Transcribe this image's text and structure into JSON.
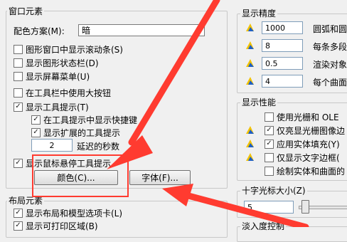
{
  "window_elements": {
    "title": "窗口元素",
    "color_scheme_label": "配色方案(M):",
    "color_scheme_value": "暗",
    "checkboxes": [
      {
        "label": "图形窗口中显示滚动条(S)",
        "checked": false
      },
      {
        "label": "显示图形状态栏(D)",
        "checked": false
      },
      {
        "label": "显示屏幕菜单(U)",
        "checked": false
      },
      {
        "label": "在工具栏中使用大按钮",
        "checked": false
      },
      {
        "label": "显示工具提示(T)",
        "checked": true
      },
      {
        "label": "在工具提示中显示快捷键",
        "checked": true
      },
      {
        "label": "显示扩展的工具提示",
        "checked": true
      }
    ],
    "delay_value": "2",
    "delay_label": "延迟的秒数",
    "rollover_checkbox": {
      "label": "显示鼠标悬停工具提示",
      "checked": true
    },
    "colors_button": "颜色(C)...",
    "fonts_button": "字体(F)..."
  },
  "layout_elements": {
    "title": "布局元素",
    "checkboxes": [
      {
        "label": "显示布局和模型选项卡(L)",
        "checked": true
      },
      {
        "label": "显示可打印区域(B)",
        "checked": true
      }
    ]
  },
  "display_resolution": {
    "title": "显示精度",
    "items": [
      {
        "value": "1000",
        "label": "圆弧和圆"
      },
      {
        "value": "8",
        "label": "每条多段"
      },
      {
        "value": "0.5",
        "label": "渲染对象"
      },
      {
        "value": "4",
        "label": "每个曲面"
      }
    ]
  },
  "display_performance": {
    "title": "显示性能",
    "items": [
      {
        "label": "使用光栅和 OLE",
        "checked": false,
        "icon": false
      },
      {
        "label": "仅亮显光栅图像边",
        "checked": true,
        "icon": true
      },
      {
        "label": "应用实体填充(Y)",
        "checked": true,
        "icon": true
      },
      {
        "label": "仅显示文字边框(",
        "checked": false,
        "icon": true
      },
      {
        "label": "绘制实体和曲面的",
        "checked": false,
        "icon": false
      }
    ]
  },
  "crosshair": {
    "title": "十字光标大小(Z)",
    "value": "5",
    "slider_fraction": 0.05
  },
  "fade_control": {
    "title": "淡入度控制"
  },
  "colors": {
    "highlight": "#ff3b30",
    "icon_yellow": "#f2c200",
    "icon_blue": "#1e5fc6",
    "check": "#222222"
  }
}
